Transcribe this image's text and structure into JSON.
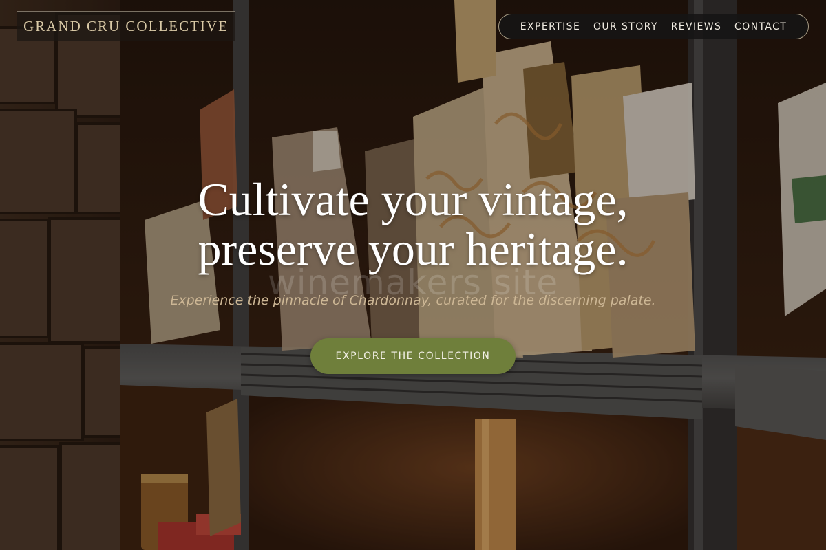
{
  "brand": {
    "name": "GRAND CRU COLLECTIVE"
  },
  "nav": {
    "items": [
      {
        "label": "EXPERTISE"
      },
      {
        "label": "OUR STORY"
      },
      {
        "label": "REVIEWS"
      },
      {
        "label": "CONTACT"
      }
    ]
  },
  "hero": {
    "headline_line1": "Cultivate your vintage,",
    "headline_line2": "preserve your heritage.",
    "watermark": "winemakers site",
    "subtitle": "Experience the pinnacle of Chardonnay, curated for the discerning palate.",
    "cta_label": "EXPLORE THE COLLECTION"
  },
  "colors": {
    "accent_button": "#6f7f3b",
    "logo_text": "#d9c9a6",
    "subtitle_text": "#cdb795"
  }
}
